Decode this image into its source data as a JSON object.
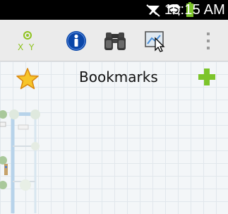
{
  "status_bar": {
    "time": "10:15 AM"
  },
  "action_bar": {
    "xy_label": "X Y"
  },
  "bookmarks": {
    "title": "Bookmarks"
  },
  "colors": {
    "status_bg": "#000000",
    "actionbar_bg": "#ebebeb",
    "accent_green": "#7cc42a",
    "star_yellow": "#f7c529",
    "info_blue": "#0a46a8"
  }
}
